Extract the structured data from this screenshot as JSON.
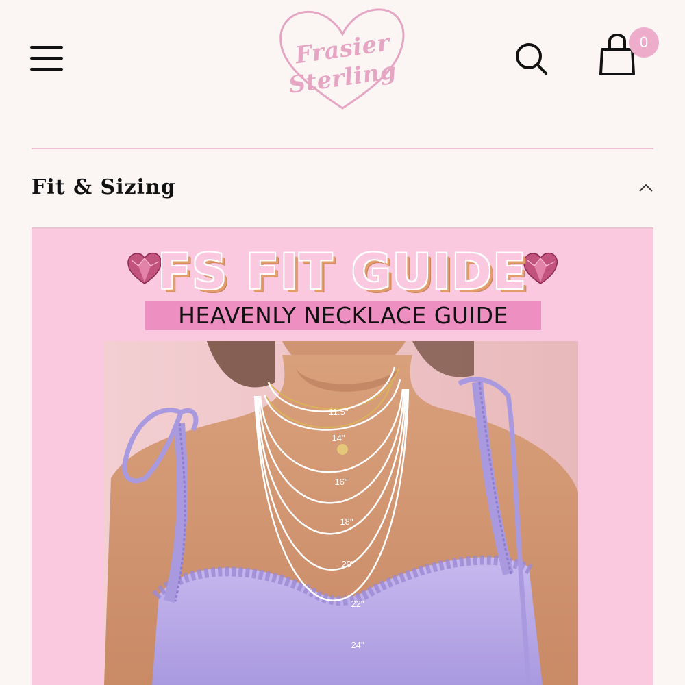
{
  "header": {
    "menu_icon": "hamburger-menu-icon",
    "logo": {
      "line1": "Frasier",
      "line2": "Sterling",
      "color": "#e5a6c4"
    },
    "search_icon": "search-icon",
    "cart_icon": "shopping-bag-icon",
    "cart_count": "0"
  },
  "accordion": {
    "title": "Fit & Sizing",
    "chevron_icon": "chevron-up-icon",
    "expanded": true
  },
  "guide": {
    "title": "FS FIT GUIDE",
    "subtitle": "HEAVENLY NECKLACE GUIDE",
    "gem_icon": "pink-heart-gem-icon",
    "necklace_lengths": [
      "11.5\"",
      "14\"",
      "16\"",
      "18\"",
      "20\"",
      "22\"",
      "24\""
    ]
  },
  "colors": {
    "background": "#fbf6f4",
    "accent_pink": "#eeaccb",
    "guide_background": "#fbc9df",
    "subtitle_bar": "#ee8fc1",
    "divider": "#ecc1d1"
  }
}
